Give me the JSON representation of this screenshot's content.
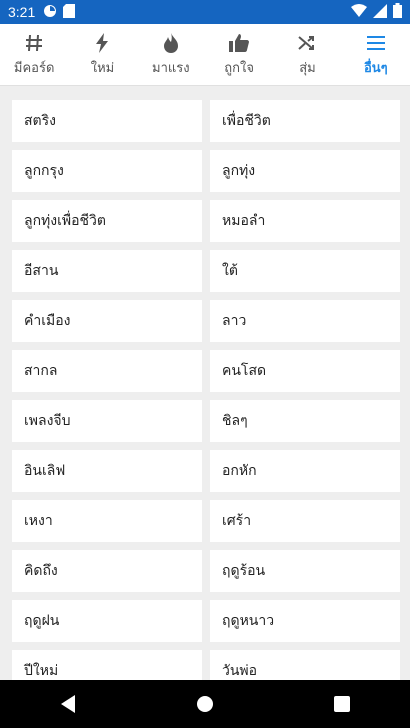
{
  "status_bar": {
    "time": "3:21",
    "icons": [
      "app-notification-icon",
      "sd-card-icon",
      "wifi-icon",
      "signal-icon",
      "battery-icon"
    ]
  },
  "tabs": [
    {
      "label": "มีคอร์ด",
      "icon": "hash-icon",
      "active": false
    },
    {
      "label": "ใหม่",
      "icon": "lightning-icon",
      "active": false
    },
    {
      "label": "มาแรง",
      "icon": "flame-icon",
      "active": false
    },
    {
      "label": "ถูกใจ",
      "icon": "thumbs-up-icon",
      "active": false
    },
    {
      "label": "สุ่ม",
      "icon": "shuffle-icon",
      "active": false
    },
    {
      "label": "อื่นๆ",
      "icon": "menu-icon",
      "active": true
    }
  ],
  "categories": [
    "สตริง",
    "เพื่อชีวิต",
    "ลูกกรุง",
    "ลูกทุ่ง",
    "ลูกทุ่งเพื่อชีวิต",
    "หมอลำ",
    "อีสาน",
    "ใต้",
    "คำเมือง",
    "ลาว",
    "สากล",
    "คนโสด",
    "เพลงจีบ",
    "ชิลๆ",
    "อินเลิฟ",
    "อกหัก",
    "เหงา",
    "เศร้า",
    "คิดถึง",
    "ฤดูร้อน",
    "ฤดูฝน",
    "ฤดูหนาว",
    "ปีใหม่",
    "วันพ่อ"
  ],
  "colors": {
    "status_bar": "#1565c0",
    "accent": "#1e88e5",
    "background": "#eeeeee"
  },
  "nav_buttons": [
    "back-icon",
    "home-icon",
    "recents-icon"
  ]
}
